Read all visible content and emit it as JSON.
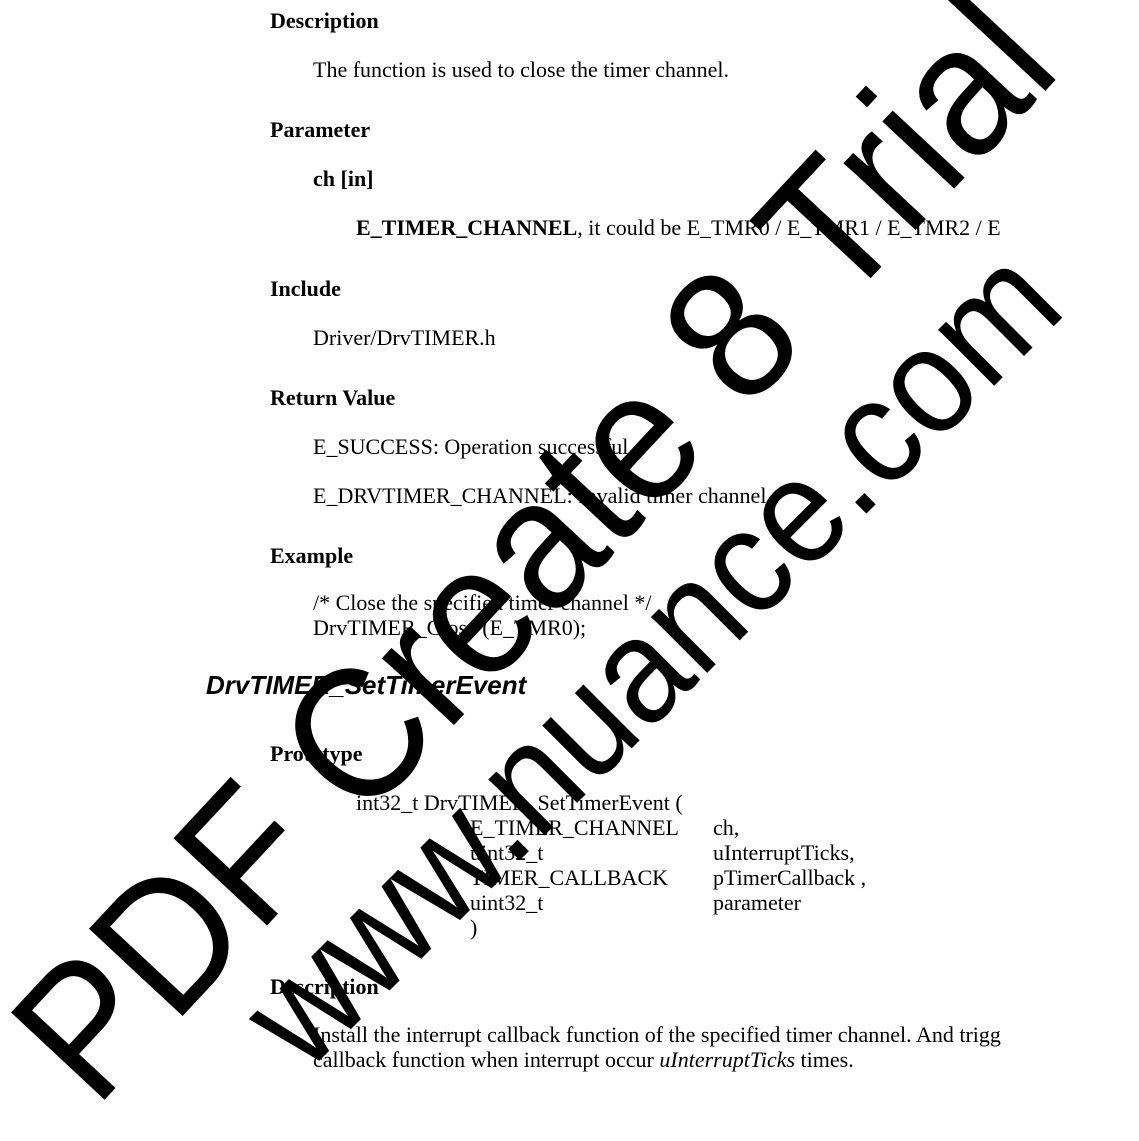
{
  "section1": {
    "description_heading": "Description",
    "description_text": "The function is used to close the timer channel.",
    "parameter_heading": "Parameter",
    "param_name": "ch [in]",
    "param_type": "E_TIMER_CHANNEL",
    "param_desc": ", it could be E_TMR0 / E_TMR1 / E_TMR2 / E",
    "include_heading": "Include",
    "include_text": "Driver/DrvTIMER.h",
    "return_heading": "Return Value",
    "return_line1": "E_SUCCESS: Operation successful",
    "return_line2": "E_DRVTIMER_CHANNEL: Invalid timer channel",
    "example_heading": "Example",
    "example_line1": "/* Close the specified timer channel */",
    "example_line2": "DrvTIMER_Close (E_TMR0);"
  },
  "section2": {
    "function_name": "DrvTIMER_SetTimerEvent",
    "prototype_heading": "Prototype",
    "proto_line1": "int32_t DrvTIMER_SetTimerEvent (",
    "proto_rows": [
      {
        "type": "E_TIMER_CHANNEL",
        "name": "ch,"
      },
      {
        "type": "uint32_t",
        "name": "uInterruptTicks,"
      },
      {
        "type": "TIMER_CALLBACK",
        "name": "pTimerCallback ,"
      },
      {
        "type": "uint32_t",
        "name": "parameter"
      }
    ],
    "proto_close": ")",
    "description_heading": "Description",
    "description_line1": "Install the interrupt callback function of the specified timer channel. And trigg",
    "description_line2_pre": "callback function when interrupt occur ",
    "description_line2_italic": "uInterruptTicks",
    "description_line2_post": " times."
  },
  "watermark": {
    "line1": "PDF Create 8 Trial",
    "line2": "www.nuance.com",
    "color": "#000000"
  }
}
